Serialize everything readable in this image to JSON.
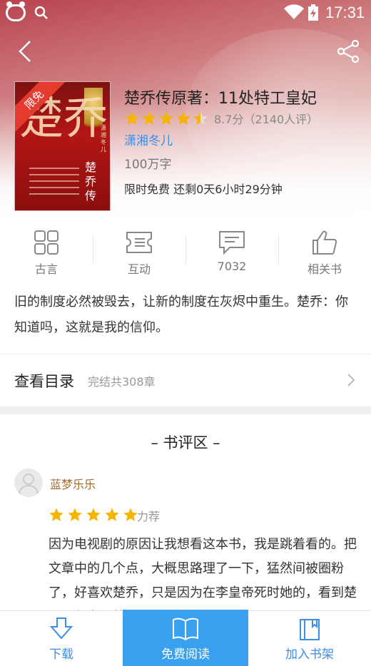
{
  "status_bar": {
    "time": "17:31"
  },
  "book": {
    "title": "楚乔传原著：11处特工皇妃",
    "rating_text": "8.7分（2140人评）",
    "rating_stars": 4.5,
    "author": "潇湘冬儿",
    "word_count": "100万字",
    "promo": "限时免费 还剩0天6小时29分钟",
    "cover": {
      "badge": "限免",
      "big_text": "楚乔",
      "vertical_title": "楚乔传",
      "vertical_author": "潇湘冬儿"
    }
  },
  "actions": [
    {
      "label": "古言",
      "icon": "grid-icon"
    },
    {
      "label": "互动",
      "icon": "ticket-icon"
    },
    {
      "label": "7032",
      "icon": "comment-icon"
    },
    {
      "label": "相关书",
      "icon": "thumbs-up-icon"
    }
  ],
  "description": "旧的制度必然被毁去，让新的制度在灰烬中重生。楚乔：你知道吗，这就是我的信仰。",
  "toc": {
    "title": "查看目录",
    "subtitle": "完结共308章"
  },
  "reviews": {
    "heading": "– 书评区 –",
    "items": [
      {
        "user": "蓝梦乐乐",
        "stars": 5,
        "tag": "力荐",
        "text": "因为电视剧的原因让我想看这本书，我是跳着看的。把文章中的几个点，大概思路理了一下，猛然间被圈粉了，好喜欢楚乔，只是因为在李皇帝死时她的，看到楚国，作者写的真的很好，很"
      }
    ]
  },
  "bottom_bar": {
    "download": "下载",
    "read": "免费阅读",
    "add_shelf": "加入书架"
  },
  "colors": {
    "accent": "#3aa0f0",
    "link": "#3a8ee6",
    "star": "#f5b400",
    "badge": "#e53b2f"
  }
}
